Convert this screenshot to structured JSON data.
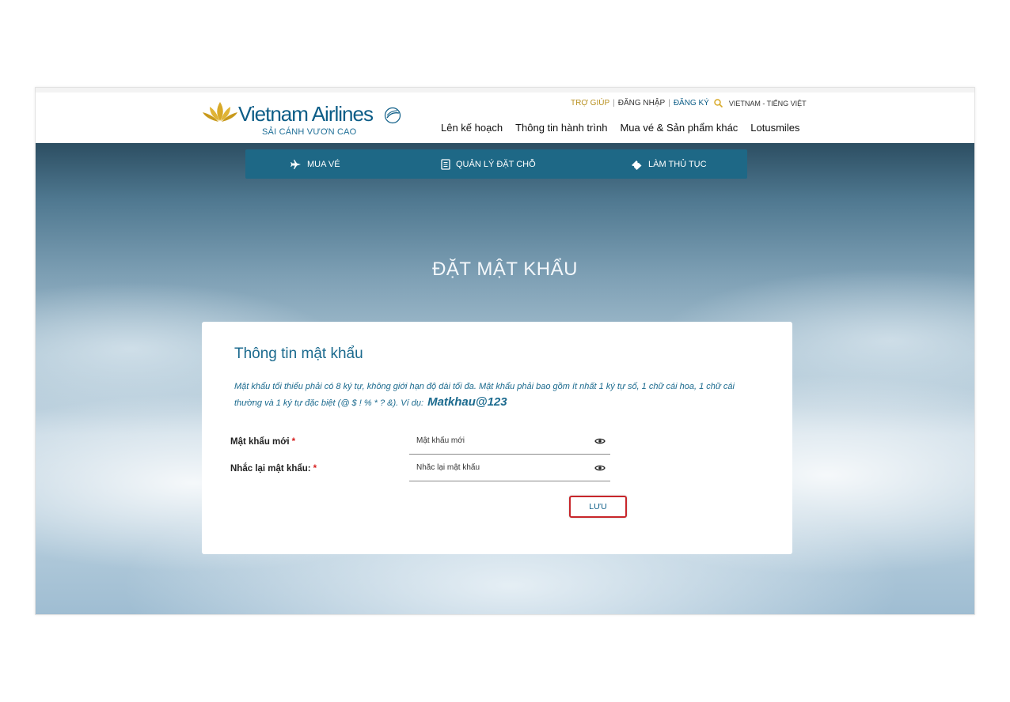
{
  "header": {
    "brand_name": "Vietnam Airlines",
    "slogan": "SẢI CÁNH VƯƠN CAO",
    "utility": {
      "help": "TRỢ GIÚP",
      "login": "ĐĂNG NHẬP",
      "register": "ĐĂNG KÝ",
      "language": "VIETNAM - TIẾNG VIỆT"
    },
    "nav": [
      {
        "label": "Lên kế hoạch"
      },
      {
        "label": "Thông tin hành trình"
      },
      {
        "label": "Mua vé & Sản phẩm khác"
      },
      {
        "label": "Lotusmiles"
      }
    ]
  },
  "tabs": [
    {
      "label": "MUA VÉ",
      "icon": "plane-icon"
    },
    {
      "label": "QUẢN LÝ ĐẶT CHỖ",
      "icon": "booking-book-icon"
    },
    {
      "label": "LÀM THỦ TỤC",
      "icon": "ticket-icon"
    }
  ],
  "page_title": "ĐẶT MẬT KHẨU",
  "form": {
    "title": "Thông tin mật khẩu",
    "hint": "Mật khẩu tối thiểu phải có 8 ký tự, không giới hạn độ dài tối đa. Mật khẩu phải bao gồm ít nhất 1 ký tự số, 1 chữ cái hoa, 1 chữ cái thường và 1 ký tự đặc biệt (@ $ ! % * ? &). Ví dụ:",
    "hint_example": "Matkhau@123",
    "fields": [
      {
        "label": "Mật khẩu mới",
        "required_mark": "*",
        "placeholder": "Mật khẩu mới",
        "value": ""
      },
      {
        "label": "Nhắc lại mật khẩu:",
        "required_mark": "*",
        "placeholder": "Nhắc lại mật khẩu",
        "value": ""
      }
    ],
    "save_label": "LƯU"
  },
  "colors": {
    "brand_blue": "#0c5d87",
    "gold": "#d8a928",
    "tab_bar": "#1e6886",
    "required": "#d61f1f",
    "save_border": "#c8262b"
  }
}
